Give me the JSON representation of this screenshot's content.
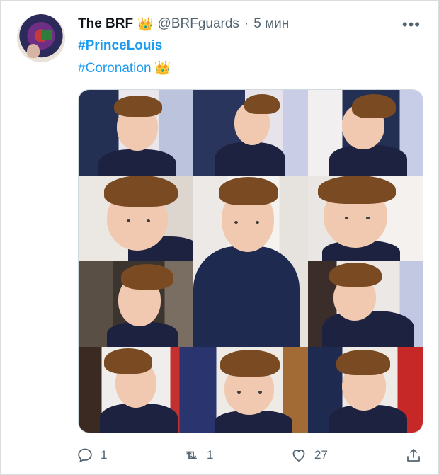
{
  "tweet": {
    "author_name": "The BRF",
    "badge_emoji": "👑",
    "handle": "@BRFguards",
    "separator": "·",
    "time": "5 мин",
    "more_icon": "more-horizontal-icon",
    "hashtag1": "#PrinceLouis",
    "hashtag2": "#Coronation",
    "hashtag2_emoji": "👑",
    "media_description": "Collage of 12 photos of Prince Louis at the coronation"
  },
  "actions": {
    "replies": "1",
    "retweets": "1",
    "likes": "27"
  },
  "colors": {
    "link": "#1d9bf0",
    "muted": "#536471",
    "coat": "#1c2240",
    "hair": "#7a4a22"
  }
}
